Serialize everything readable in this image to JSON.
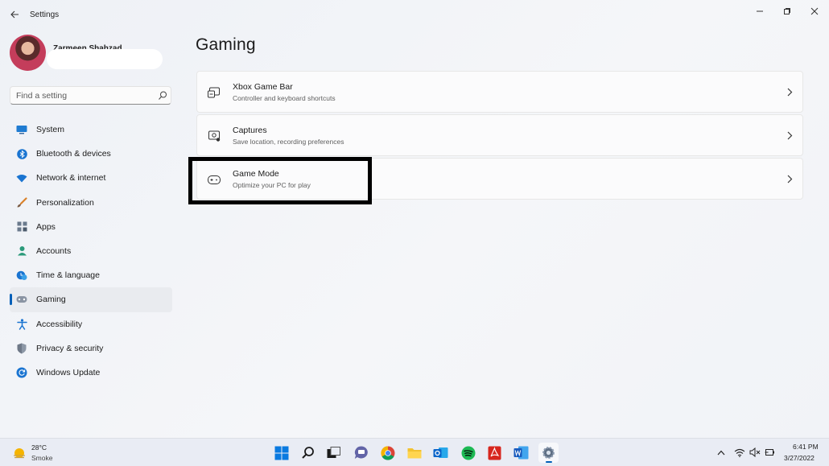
{
  "window": {
    "title": "Settings"
  },
  "profile": {
    "name": "Zarmeen Shahzad"
  },
  "search": {
    "placeholder": "Find a setting"
  },
  "sidebar": {
    "items": [
      {
        "label": "System",
        "icon": "monitor-icon"
      },
      {
        "label": "Bluetooth & devices",
        "icon": "bluetooth-icon"
      },
      {
        "label": "Network & internet",
        "icon": "wifi-icon"
      },
      {
        "label": "Personalization",
        "icon": "brush-icon"
      },
      {
        "label": "Apps",
        "icon": "apps-icon"
      },
      {
        "label": "Accounts",
        "icon": "person-icon"
      },
      {
        "label": "Time & language",
        "icon": "clock-globe-icon"
      },
      {
        "label": "Gaming",
        "icon": "gamepad-icon",
        "selected": true
      },
      {
        "label": "Accessibility",
        "icon": "accessibility-icon"
      },
      {
        "label": "Privacy & security",
        "icon": "shield-icon"
      },
      {
        "label": "Windows Update",
        "icon": "update-icon"
      }
    ]
  },
  "main": {
    "title": "Gaming",
    "cards": [
      {
        "title": "Xbox Game Bar",
        "subtitle": "Controller and keyboard shortcuts",
        "icon": "game-bar-icon"
      },
      {
        "title": "Captures",
        "subtitle": "Save location, recording preferences",
        "icon": "capture-icon"
      },
      {
        "title": "Game Mode",
        "subtitle": "Optimize your PC for play",
        "icon": "gamepad-icon",
        "highlighted": true
      }
    ]
  },
  "taskbar": {
    "weather": {
      "temp": "28°C",
      "condition": "Smoke"
    },
    "apps": [
      "start-icon",
      "search-icon",
      "task-view-icon",
      "teams-chat-icon",
      "chrome-icon",
      "file-explorer-icon",
      "outlook-icon",
      "spotify-icon",
      "acrobat-icon",
      "word-icon",
      "settings-icon"
    ],
    "clock": {
      "time": "6:41 PM",
      "date": "3/27/2022"
    }
  },
  "colors": {
    "accent": "#005fb8",
    "highlight_border": "#000000"
  }
}
